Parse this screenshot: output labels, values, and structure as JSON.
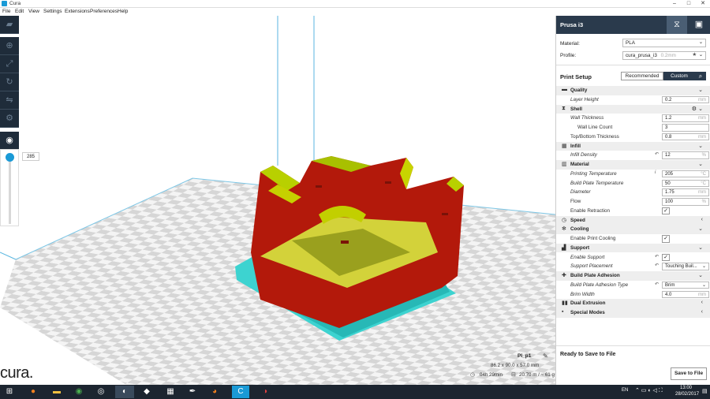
{
  "window": {
    "title": "Cura"
  },
  "menu": [
    "File",
    "Edit",
    "View",
    "Settings",
    "Extensions",
    "Preferences",
    "Help"
  ],
  "viewport": {
    "layer_value": "285",
    "job_name": "PI_p1",
    "dimensions": "86.2 x 90.0 x 57.0 mm",
    "print_time": "04h 29min",
    "filament": "20.70 m / ~ 61 g",
    "logo": "cura."
  },
  "sidebar": {
    "printer": "Prusa i3",
    "material_label": "Material:",
    "material_value": "PLA",
    "profile_label": "Profile:",
    "profile_value": "cura_prusa_i3",
    "profile_hint": "0.2mm",
    "print_setup_title": "Print Setup",
    "tab_recommended": "Recommended",
    "tab_custom": "Custom",
    "settings": [
      {
        "kind": "cat",
        "label": "Quality",
        "icon": "quality-icon",
        "glyph": "▬",
        "chev": "⌄"
      },
      {
        "kind": "row",
        "label": "Layer Height",
        "italic": true,
        "value": "0.2",
        "unit": "mm"
      },
      {
        "kind": "cat",
        "label": "Shell",
        "icon": "shell-icon",
        "glyph": "⧗",
        "chev": "⌄",
        "gear": true
      },
      {
        "kind": "row",
        "label": "Wall Thickness",
        "italic": true,
        "value": "1.2",
        "unit": "mm"
      },
      {
        "kind": "row",
        "label": "Wall Line Count",
        "indent": true,
        "value": "3",
        "unit": ""
      },
      {
        "kind": "row",
        "label": "Top/Bottom Thickness",
        "value": "0.8",
        "unit": "mm"
      },
      {
        "kind": "cat",
        "label": "Infill",
        "icon": "infill-icon",
        "glyph": "▦",
        "chev": "⌄"
      },
      {
        "kind": "row",
        "label": "Infill Density",
        "italic": true,
        "reset": true,
        "value": "12",
        "unit": "%"
      },
      {
        "kind": "cat",
        "label": "Material",
        "icon": "material-icon",
        "glyph": "▥",
        "chev": "⌄"
      },
      {
        "kind": "row",
        "label": "Printing Temperature",
        "italic": true,
        "info": true,
        "value": "205",
        "unit": "°C"
      },
      {
        "kind": "row",
        "label": "Build Plate Temperature",
        "italic": true,
        "value": "50",
        "unit": "°C"
      },
      {
        "kind": "row",
        "label": "Diameter",
        "italic": true,
        "value": "1.75",
        "unit": "mm"
      },
      {
        "kind": "row",
        "label": "Flow",
        "value": "100",
        "unit": "%"
      },
      {
        "kind": "check",
        "label": "Enable Retraction",
        "checked": true
      },
      {
        "kind": "cat",
        "label": "Speed",
        "icon": "speed-icon",
        "glyph": "◷",
        "chev": "‹"
      },
      {
        "kind": "cat",
        "label": "Cooling",
        "icon": "cooling-icon",
        "glyph": "✻",
        "chev": "⌄"
      },
      {
        "kind": "check",
        "label": "Enable Print Cooling",
        "checked": true
      },
      {
        "kind": "cat",
        "label": "Support",
        "icon": "support-icon",
        "glyph": "▟",
        "chev": "⌄"
      },
      {
        "kind": "check",
        "label": "Enable Support",
        "italic": true,
        "reset": true,
        "checked": true
      },
      {
        "kind": "select",
        "label": "Support Placement",
        "italic": true,
        "reset": true,
        "value": "Touching Buil..."
      },
      {
        "kind": "cat",
        "label": "Build Plate Adhesion",
        "icon": "adhesion-icon",
        "glyph": "✚",
        "chev": "⌄"
      },
      {
        "kind": "select",
        "label": "Build Plate Adhesion Type",
        "italic": true,
        "reset": true,
        "value": "Brim"
      },
      {
        "kind": "row",
        "label": "Brim Width",
        "italic": true,
        "value": "4.0",
        "unit": "mm"
      },
      {
        "kind": "cat",
        "label": "Dual Extrusion",
        "icon": "dual-extrusion-icon",
        "glyph": "▮▮",
        "chev": "‹"
      },
      {
        "kind": "cat",
        "label": "Special Modes",
        "icon": "special-modes-icon",
        "glyph": "▪",
        "chev": "‹"
      }
    ],
    "ready_text": "Ready to Save to File",
    "save_button": "Save to File"
  },
  "taskbar": {
    "lang": "EN",
    "time": "13:00",
    "date": "28/02/2017"
  },
  "colors": {
    "accent": "#1a9ad6",
    "sidebar_dark": "#2a3a4c",
    "model": "#b11a0a",
    "support": "#30c6c4",
    "top": "#c4d400"
  }
}
